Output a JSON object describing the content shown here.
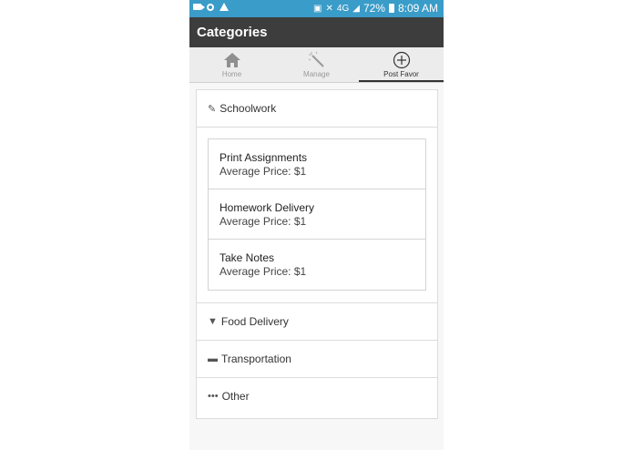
{
  "status_bar": {
    "battery": "72%",
    "time": "8:09 AM",
    "network": "4G",
    "colors": {
      "bar": "#3a9cc8"
    }
  },
  "app_bar": {
    "title": "Categories",
    "color": "#3d3d3d"
  },
  "tabs": [
    {
      "label": "Home",
      "icon": "home-icon",
      "active": false
    },
    {
      "label": "Manage",
      "icon": "magic-wand-icon",
      "active": false
    },
    {
      "label": "Post Favor",
      "icon": "plus-circle-icon",
      "active": true
    }
  ],
  "categories": [
    {
      "label": "Schoolwork",
      "icon": "pencil-icon",
      "expanded": true,
      "items": [
        {
          "name": "Print Assignments",
          "price": "Average Price: $1"
        },
        {
          "name": "Homework Delivery",
          "price": "Average Price: $1"
        },
        {
          "name": "Take Notes",
          "price": "Average Price: $1"
        }
      ]
    },
    {
      "label": "Food Delivery",
      "icon": "pizza-icon",
      "expanded": false
    },
    {
      "label": "Transportation",
      "icon": "car-icon",
      "expanded": false
    },
    {
      "label": "Other",
      "icon": "ellipsis-icon",
      "expanded": false
    }
  ]
}
